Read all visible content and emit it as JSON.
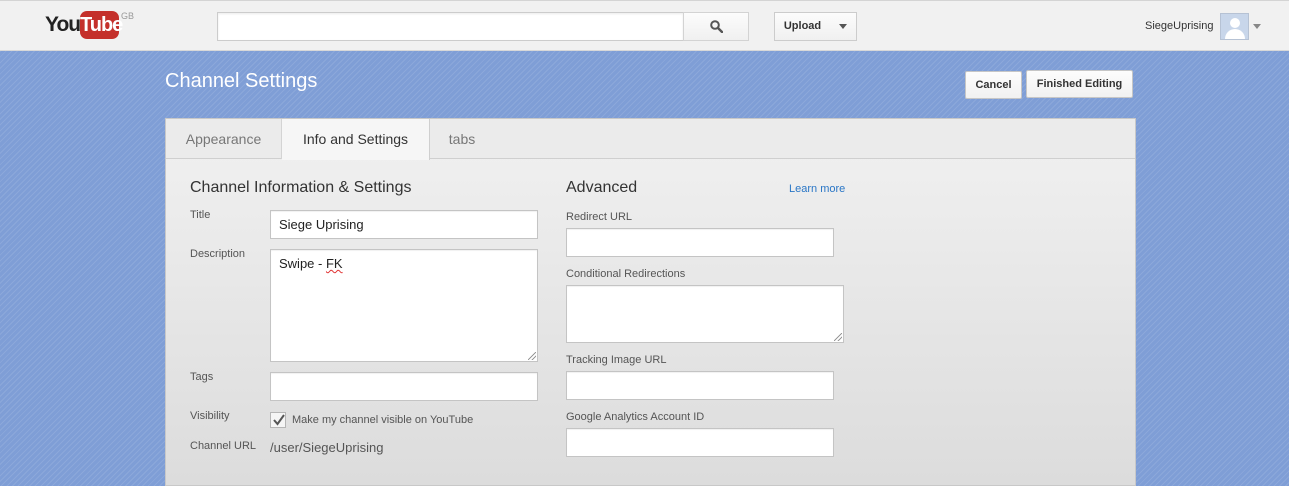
{
  "masthead": {
    "logo_you": "You",
    "logo_tube": "Tube",
    "logo_region": "GB",
    "search_value": "",
    "search_icon": "search-icon",
    "upload_label": "Upload",
    "username": "SiegeUprising",
    "avatar_icon": "default-avatar-icon"
  },
  "header": {
    "title": "Channel Settings",
    "cancel_label": "Cancel",
    "finish_label": "Finished Editing"
  },
  "tabs": [
    {
      "label": "Appearance",
      "active": false
    },
    {
      "label": "Info and Settings",
      "active": true
    },
    {
      "label": "tabs",
      "active": false
    }
  ],
  "info": {
    "section_title": "Channel Information & Settings",
    "title_label": "Title",
    "title_value": "Siege Uprising",
    "description_label": "Description",
    "description_plain": "Swipe - ",
    "description_misspelled": "FK",
    "tags_label": "Tags",
    "tags_value": "",
    "visibility_label": "Visibility",
    "visibility_checked": true,
    "visibility_text": "Make my channel visible on YouTube",
    "channel_url_label": "Channel URL",
    "channel_url_value": "/user/SiegeUprising"
  },
  "advanced": {
    "section_title": "Advanced",
    "learn_more": "Learn more",
    "redirect_label": "Redirect URL",
    "redirect_value": "",
    "conditional_label": "Conditional Redirections",
    "conditional_value": "",
    "tracking_label": "Tracking Image URL",
    "tracking_value": "",
    "analytics_label": "Google Analytics Account ID",
    "analytics_value": ""
  },
  "colors": {
    "background": "#7f9ed6",
    "brand_red": "#c4302b",
    "link": "#2a76c6"
  }
}
